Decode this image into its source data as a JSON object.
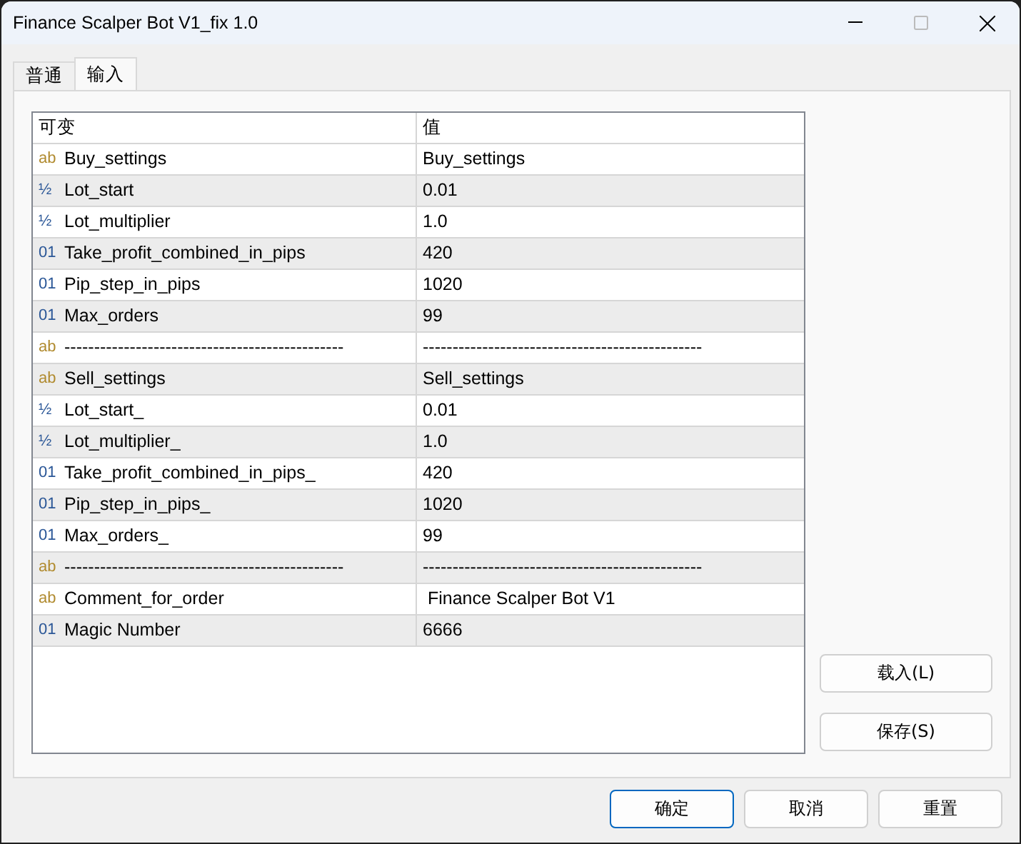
{
  "window": {
    "title": "Finance Scalper Bot V1_fix 1.0"
  },
  "tabs": [
    {
      "label": "普通",
      "selected": false
    },
    {
      "label": "输入",
      "selected": true
    }
  ],
  "table": {
    "columns": [
      "可变",
      "值"
    ],
    "rows": [
      {
        "kind": "string",
        "icon": "ab",
        "name": "Buy_settings",
        "value": "Buy_settings"
      },
      {
        "kind": "double",
        "icon": "½",
        "name": "Lot_start",
        "value": "0.01"
      },
      {
        "kind": "double",
        "icon": "½",
        "name": "Lot_multiplier",
        "value": "1.0"
      },
      {
        "kind": "int",
        "icon": "01",
        "name": "Take_profit_combined_in_pips",
        "value": "420"
      },
      {
        "kind": "int",
        "icon": "01",
        "name": "Pip_step_in_pips",
        "value": "1020"
      },
      {
        "kind": "int",
        "icon": "01",
        "name": "Max_orders",
        "value": "99"
      },
      {
        "kind": "string",
        "icon": "ab",
        "name": "-----------------------------------------------",
        "value": "-----------------------------------------------"
      },
      {
        "kind": "string",
        "icon": "ab",
        "name": "Sell_settings",
        "value": "Sell_settings"
      },
      {
        "kind": "double",
        "icon": "½",
        "name": "Lot_start_",
        "value": "0.01"
      },
      {
        "kind": "double",
        "icon": "½",
        "name": "Lot_multiplier_",
        "value": "1.0"
      },
      {
        "kind": "int",
        "icon": "01",
        "name": "Take_profit_combined_in_pips_",
        "value": "420"
      },
      {
        "kind": "int",
        "icon": "01",
        "name": "Pip_step_in_pips_",
        "value": "1020"
      },
      {
        "kind": "int",
        "icon": "01",
        "name": "Max_orders_",
        "value": "99"
      },
      {
        "kind": "string",
        "icon": "ab",
        "name": "-----------------------------------------------",
        "value": "-----------------------------------------------"
      },
      {
        "kind": "string",
        "icon": "ab",
        "name": "Comment_for_order",
        "value": " Finance Scalper Bot V1"
      },
      {
        "kind": "int",
        "icon": "01",
        "name": "Magic Number",
        "value": "6666"
      }
    ]
  },
  "side_buttons": [
    "载入(L)",
    "保存(S)"
  ],
  "buttons": [
    {
      "label": "确定",
      "default": true
    },
    {
      "label": "取消",
      "default": false
    },
    {
      "label": "重置",
      "default": false
    }
  ]
}
